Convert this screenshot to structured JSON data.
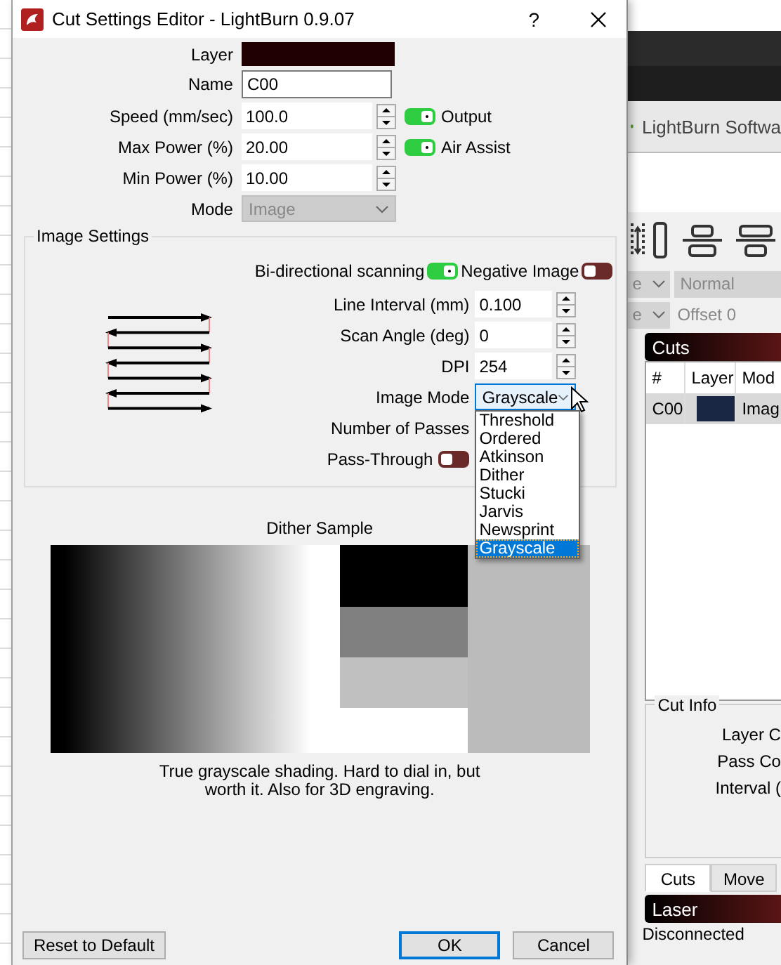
{
  "dialog": {
    "title": "Cut Settings Editor - LightBurn 0.9.07",
    "help": "?"
  },
  "fields": [
    {
      "kind": "swatch",
      "label": "Layer",
      "color": "#200000"
    },
    {
      "kind": "text",
      "label": "Name",
      "value": "C00"
    },
    {
      "kind": "spin",
      "label": "Speed (mm/sec)",
      "value": "100.0",
      "toggle": {
        "label": "Output",
        "on": true
      }
    },
    {
      "kind": "spin",
      "label": "Max Power (%)",
      "value": "20.00",
      "toggle": {
        "label": "Air Assist",
        "on": true
      }
    },
    {
      "kind": "spin",
      "label": "Min Power (%)",
      "value": "10.00"
    },
    {
      "kind": "combo",
      "label": "Mode",
      "value": "Image",
      "disabled": true
    }
  ],
  "image_settings": {
    "title": "Image Settings",
    "toggles": [
      {
        "label": "Bi-directional scanning",
        "on": true
      },
      {
        "label": "Negative Image",
        "on": false
      }
    ],
    "fields": [
      {
        "kind": "spin",
        "label": "Line Interval (mm)",
        "value": "0.100"
      },
      {
        "kind": "spin",
        "label": "Scan Angle (deg)",
        "value": "0"
      },
      {
        "kind": "spin",
        "label": "DPI",
        "value": "254"
      },
      {
        "kind": "combo",
        "label": "Image Mode",
        "value": "Grayscale",
        "disabled": false,
        "expanded": true,
        "options": [
          {
            "label": "Threshold",
            "selected": false
          },
          {
            "label": "Ordered",
            "selected": false
          },
          {
            "label": "Atkinson",
            "selected": false
          },
          {
            "label": "Dither",
            "selected": false
          },
          {
            "label": "Stucki",
            "selected": false
          },
          {
            "label": "Jarvis",
            "selected": false
          },
          {
            "label": "Newsprint",
            "selected": false
          },
          {
            "label": "Grayscale",
            "selected": true
          }
        ]
      },
      {
        "kind": "label",
        "label": "Number of Passes"
      },
      {
        "kind": "toggle",
        "label": "Pass-Through",
        "on": false
      }
    ]
  },
  "dither_sample": {
    "title": "Dither Sample",
    "caption": "True grayscale shading. Hard to dial in, but worth it. Also for 3D engraving."
  },
  "buttons": [
    {
      "label": "Reset to Default",
      "default": false
    },
    {
      "label": "OK",
      "default": true
    },
    {
      "label": "Cancel",
      "default": false
    }
  ],
  "background_window": {
    "tab_title": "LightBurn Softwa",
    "combo_rows": [
      {
        "combo": "e",
        "field": "Normal"
      },
      {
        "combo": "e",
        "field": "Offset 0"
      }
    ],
    "cuts": {
      "title": "Cuts",
      "columns": [
        "#",
        "Layer",
        "Mod"
      ],
      "rows": [
        {
          "number": "C00",
          "color": "#1a2744",
          "mode": "Imag"
        }
      ]
    },
    "cut_info": {
      "title": "Cut Info",
      "labels": [
        "Layer C",
        "Pass Co",
        "Interval ("
      ]
    },
    "tabs": [
      {
        "label": "Cuts",
        "selected": true
      },
      {
        "label": "Move",
        "selected": false
      }
    ],
    "laser": {
      "title": "Laser",
      "status": "Disconnected"
    }
  }
}
